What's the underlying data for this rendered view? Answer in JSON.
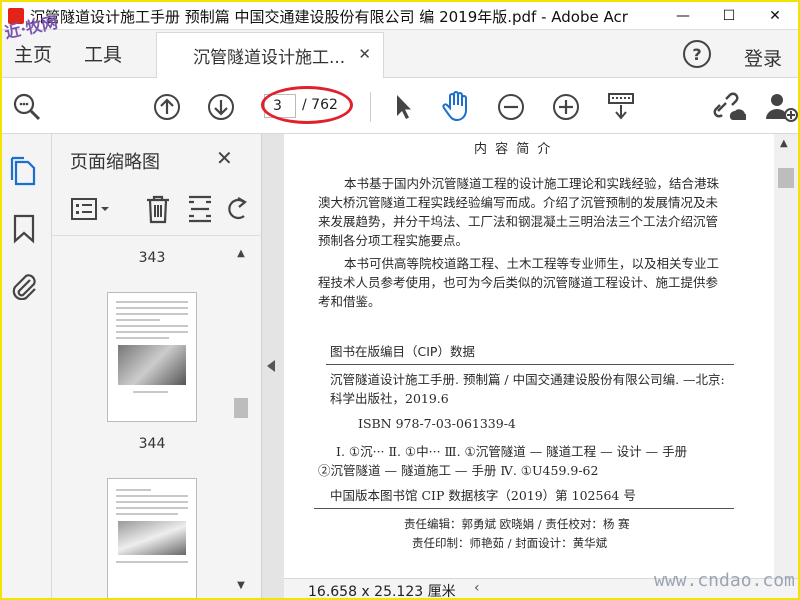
{
  "window": {
    "title": "沉管隧道设计施工手册 预制篇 中国交通建设股份有限公司 编 2019年版.pdf - Adobe Acr",
    "minimize": "—",
    "maximize": "☐",
    "close": "✕"
  },
  "watermark_tl": "近·牧网",
  "menu": {
    "home": "主页",
    "tools": "工具",
    "help": "?",
    "login": "登录"
  },
  "tab": {
    "label": "沉管隧道设计施工...",
    "close": "✕"
  },
  "toolbar": {
    "current_page": "3",
    "total_pages": "/ 762"
  },
  "panel": {
    "title": "页面缩略图",
    "close": "✕",
    "thumbnails": [
      {
        "label": "343"
      },
      {
        "label": "344"
      }
    ]
  },
  "document": {
    "heading": "内 容 简 介",
    "para1": [
      "本书基于国内外沉管隧道工程的设计施工理论和实践经验，结合港珠",
      "澳大桥沉管隧道工程实践经验编写而成。介绍了沉管预制的发展情况及未",
      "来发展趋势，并分干坞法、工厂法和钢混凝土三明治法三个工法介绍沉管",
      "预制各分项工程实施要点。"
    ],
    "para2": [
      "本书可供高等院校道路工程、土木工程等专业师生，以及相关专业工",
      "程技术人员参考使用，也可为今后类似的沉管隧道工程设计、施工提供参",
      "考和借鉴。"
    ],
    "cip_title": "图书在版编目（CIP）数据",
    "cip_lines": [
      "沉管隧道设计施工手册. 预制篇 / 中国交通建设股份有限公司编. —北京:",
      "科学出版社，2019.6"
    ],
    "isbn": "ISBN 978-7-03-061339-4",
    "class_lines": [
      "Ⅰ. ①沉···   Ⅱ. ①中···   Ⅲ. ①沉管隧道 — 隧道工程 — 设计 — 手册",
      "②沉管隧道 — 隧道施工 — 手册   Ⅳ. ①U459.9-62"
    ],
    "cip_core": "中国版本图书馆 CIP 数据核字（2019）第 102564 号",
    "editors1": "责任编辑：郭勇斌  欧晓娟 / 责任校对：杨  赛",
    "editors2": "责任印制：师艳茹 / 封面设计：黄华斌"
  },
  "status": {
    "dimensions": "16.658 x 25.123 厘米"
  },
  "watermark_br": "www.cndao.com",
  "colors": {
    "accent": "#1a6fd1",
    "annotation": "#e0202a",
    "window_border": "#f3e400"
  }
}
